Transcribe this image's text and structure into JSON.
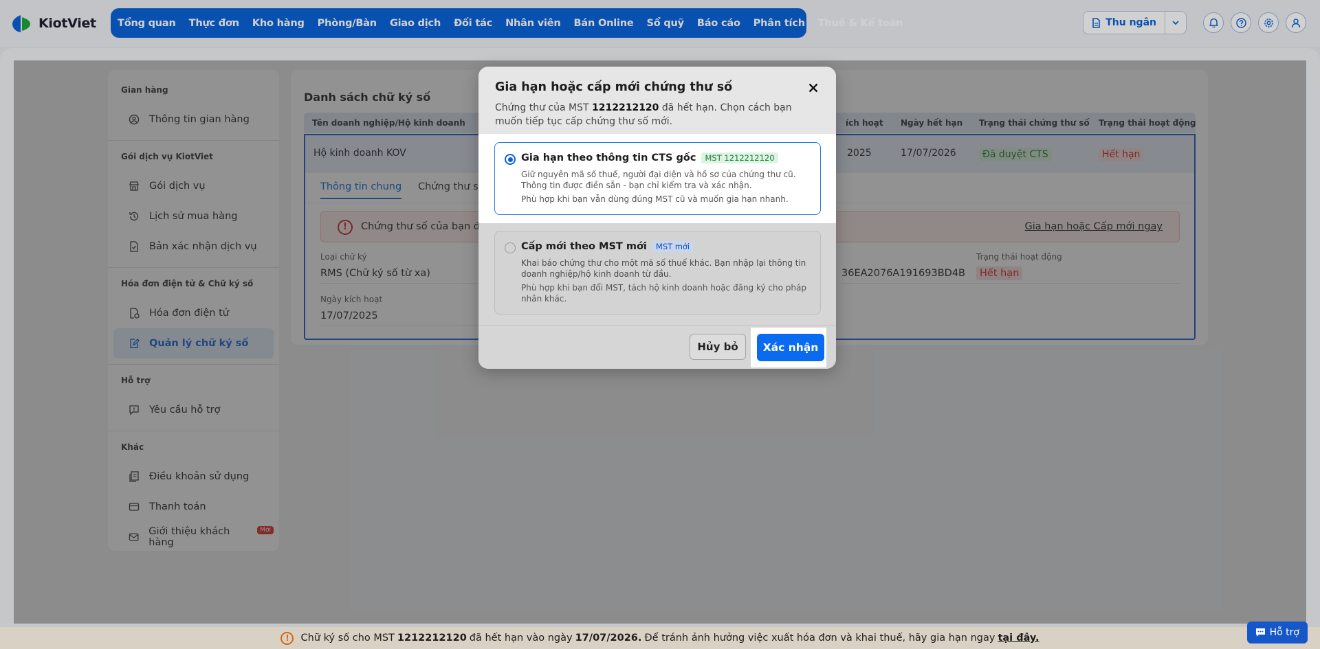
{
  "brand": {
    "name": "KiotViet"
  },
  "nav": [
    "Tổng quan",
    "Thực đơn",
    "Kho hàng",
    "Phòng/Bàn",
    "Giao dịch",
    "Đối tác",
    "Nhân viên",
    "Bán Online",
    "Sổ quỹ",
    "Báo cáo",
    "Phân tích",
    "Thuế & Kế toán"
  ],
  "toolbar": {
    "cashier_label": "Thu ngân"
  },
  "sidebar": {
    "groups": [
      {
        "title": "Gian hàng",
        "items": [
          "Thông tin gian hàng"
        ]
      },
      {
        "title": "Gói dịch vụ KiotViet",
        "items": [
          "Gói dịch vụ",
          "Lịch sử mua hàng",
          "Bản xác nhận dịch vụ"
        ]
      },
      {
        "title": "Hóa đơn điện tử & Chữ ký số",
        "items": [
          "Hóa đơn điện tử",
          "Quản lý chữ ký số"
        ]
      },
      {
        "title": "Hỗ trợ",
        "items": [
          "Yêu cầu hỗ trợ"
        ]
      },
      {
        "title": "Khác",
        "items": [
          "Điều khoản sử dụng",
          "Thanh toán",
          "Giới thiệu khách hàng"
        ]
      }
    ],
    "new_badge": "Mới"
  },
  "content": {
    "title": "Danh sách chữ ký số",
    "columns": [
      "Tên doanh nghiệp/Hộ kinh doanh",
      "ích hoạt",
      "Ngày hết hạn",
      "Trạng thái chứng thư số",
      "Trạng thái hoạt động"
    ],
    "row": {
      "name": "Hộ kinh doanh KOV",
      "activated": "2025",
      "expiry": "17/07/2026",
      "cert_status": "Đã duyệt CTS",
      "active_status": "Hết hạn"
    },
    "tabs": [
      "Thông tin chung",
      "Chứng thư số"
    ],
    "alert": {
      "text": "Chứng thư số của bạn đã",
      "link": "Gia hạn hoặc Cấp mới ngay"
    },
    "fields": {
      "sig_type_label": "Loại chữ ký",
      "sig_type_value": "RMS (Chữ ký số từ xa)",
      "activated_label": "Ngày kích hoạt",
      "activated_value": "17/07/2025",
      "serial_value": "36EA2076A191693BD4B",
      "status_label": "Trạng thái hoạt động",
      "status_value": "Hết hạn"
    }
  },
  "modal": {
    "title": "Gia hạn hoặc cấp mới chứng thư số",
    "desc_prefix": "Chứng thư của MST",
    "mst": "1212212120",
    "desc_suffix": "đã hết hạn. Chọn cách bạn muốn tiếp tục cấp chứng thư số mới.",
    "option1": {
      "title": "Gia hạn theo thông tin CTS gốc",
      "tag": "MST 1212212120",
      "text": "Giữ nguyên mã số thuế, người đại diện và hồ sơ của chứng thư cũ. Thông tin được điền sẵn - bạn chỉ kiểm tra và xác nhận.",
      "text2": "Phù hợp khi bạn vẫn dùng đúng MST cũ và muốn gia hạn nhanh."
    },
    "option2": {
      "title": "Cấp mới theo MST mới",
      "tag": "MST mới",
      "text": "Khai báo chứng thư cho một mã số thuế khác. Bạn nhập lại thông tin doanh nghiệp/hộ kinh doanh từ đầu.",
      "text2": "Phù hợp khi bạn đổi MST, tách hộ kinh doanh hoặc đăng ký cho pháp nhân khác."
    },
    "cancel_label": "Hủy bỏ",
    "confirm_label": "Xác nhận"
  },
  "banner": {
    "prefix": "Chữ ký số cho MST",
    "mst": "1212212120",
    "mid": "đã hết hạn vào ngày",
    "date": "17/07/2026.",
    "suffix": "Để tránh ảnh hưởng việc xuất hóa đơn và khai thuế, hãy gia hạn ngay",
    "link": "tại đây."
  },
  "help": {
    "label": "Hỗ trợ"
  }
}
